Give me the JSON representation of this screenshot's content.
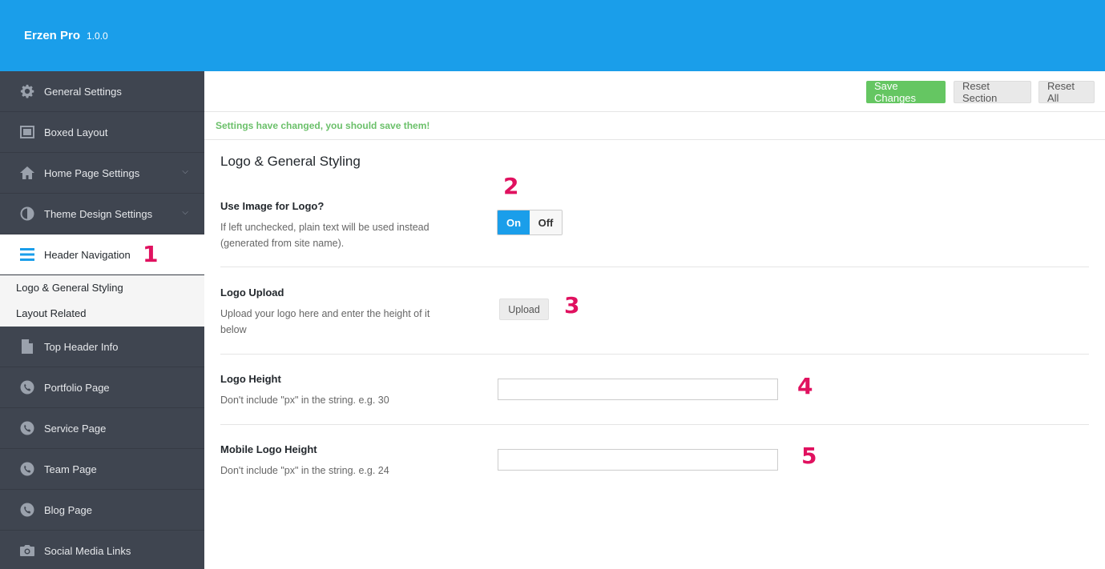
{
  "brand": {
    "name": "Erzen Pro",
    "version": "1.0.0"
  },
  "sidebar": {
    "items": [
      {
        "label": "General Settings",
        "icon": "gear-icon"
      },
      {
        "label": "Boxed Layout",
        "icon": "layout-icon"
      },
      {
        "label": "Home Page Settings",
        "icon": "home-icon",
        "expandable": true
      },
      {
        "label": "Theme Design Settings",
        "icon": "contrast-icon",
        "expandable": true
      },
      {
        "label": "Header Navigation",
        "icon": "menu-icon",
        "active": true
      },
      {
        "label": "Top Header Info",
        "icon": "document-icon"
      },
      {
        "label": "Portfolio Page",
        "icon": "phone-icon"
      },
      {
        "label": "Service Page",
        "icon": "phone-icon"
      },
      {
        "label": "Team Page",
        "icon": "phone-icon"
      },
      {
        "label": "Blog Page",
        "icon": "phone-icon"
      },
      {
        "label": "Social Media Links",
        "icon": "camera-icon"
      }
    ],
    "subitems": [
      "Logo & General Styling",
      "Layout Related"
    ]
  },
  "actions": {
    "save": "Save Changes",
    "reset_section": "Reset Section",
    "reset_all": "Reset All"
  },
  "notice": "Settings have changed, you should save them!",
  "section_title": "Logo & General Styling",
  "fields": {
    "use_image": {
      "title": "Use Image for Logo?",
      "desc": "If left unchecked, plain text will be used instead (generated from site name).",
      "on_label": "On",
      "off_label": "Off",
      "value": "On"
    },
    "logo_upload": {
      "title": "Logo Upload",
      "desc": "Upload your logo here and enter the height of it below",
      "button": "Upload"
    },
    "logo_height": {
      "title": "Logo Height",
      "desc": "Don't include \"px\" in the string. e.g. 30",
      "value": ""
    },
    "mobile_logo_height": {
      "title": "Mobile Logo Height",
      "desc": "Don't include \"px\" in the string. e.g. 24",
      "value": ""
    }
  },
  "markers": [
    "1",
    "2",
    "3",
    "4",
    "5"
  ],
  "colors": {
    "accent": "#1a9eea",
    "save_green": "#65c662",
    "sidebar_bg": "#3f4550",
    "marker": "#e0115f"
  }
}
